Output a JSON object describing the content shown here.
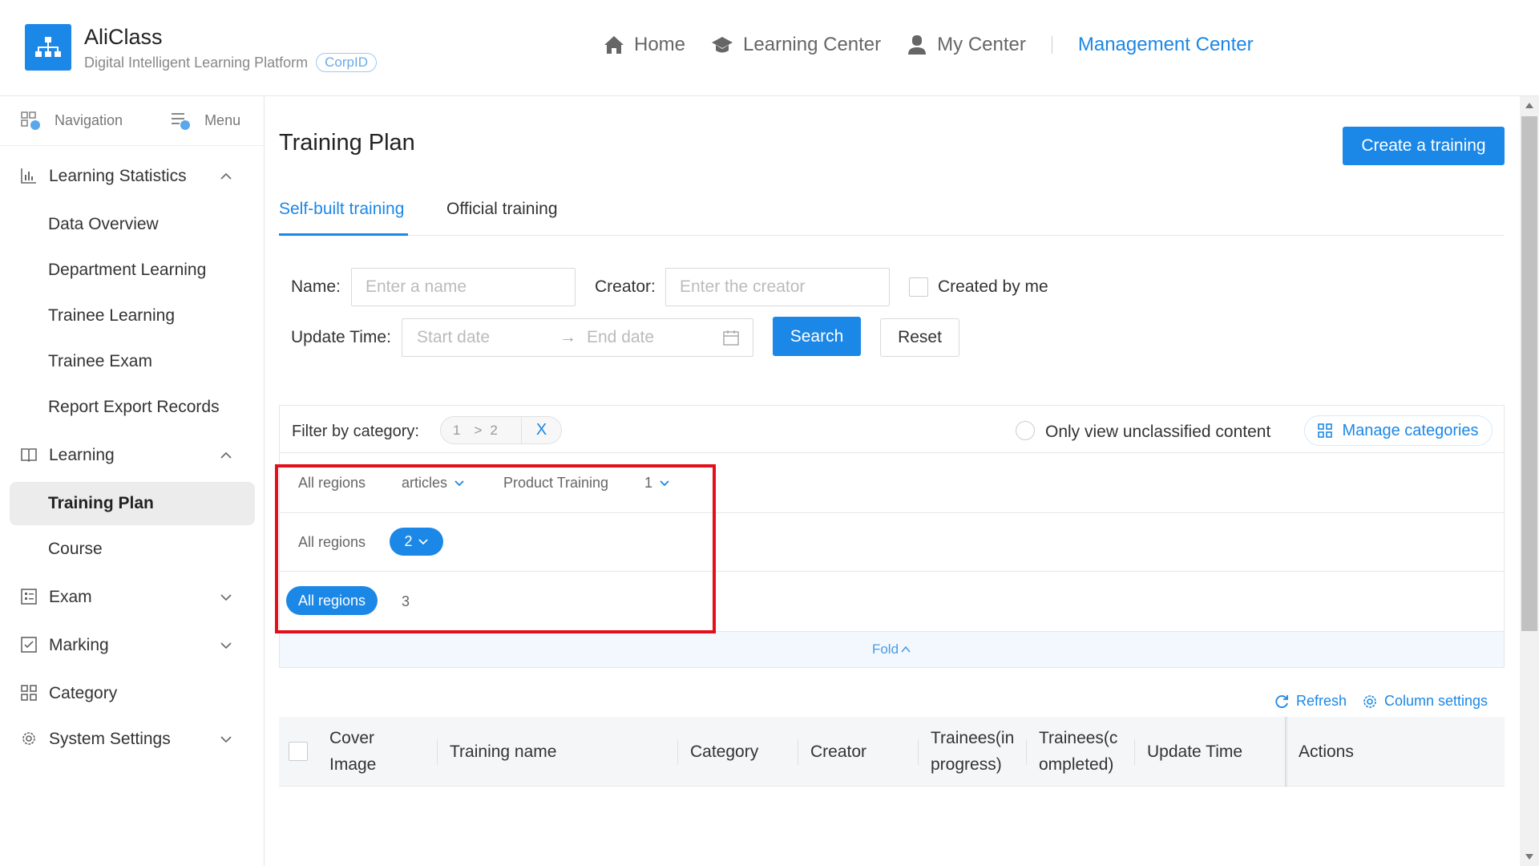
{
  "header": {
    "brand_name": "AliClass",
    "brand_sub": "Digital Intelligent Learning Platform",
    "corp_badge": "CorpID",
    "nav": {
      "home": "Home",
      "learning_center": "Learning Center",
      "my_center": "My Center",
      "management_center": "Management Center"
    },
    "accent_color": "#1b87e6"
  },
  "sidebar": {
    "navigation_label": "Navigation",
    "menu_label": "Menu",
    "groups": [
      {
        "label": "Learning Statistics",
        "icon": "bar-chart-icon",
        "expanded": true,
        "items": [
          "Data Overview",
          "Department Learning",
          "Trainee Learning",
          "Trainee Exam",
          "Report Export Records"
        ]
      },
      {
        "label": "Learning",
        "icon": "book-icon",
        "expanded": true,
        "items": [
          "Training Plan",
          "Course"
        ]
      },
      {
        "label": "Exam",
        "icon": "exam-icon",
        "expanded": false
      },
      {
        "label": "Marking",
        "icon": "marking-icon",
        "expanded": false
      },
      {
        "label": "Category",
        "icon": "category-grid-icon",
        "expanded": false
      },
      {
        "label": "System Settings",
        "icon": "gear-icon",
        "expanded": false
      }
    ],
    "active_item": "Training Plan"
  },
  "main": {
    "title": "Training Plan",
    "create_button": "Create a training",
    "tabs": [
      "Self-built training",
      "Official training"
    ],
    "active_tab": "Self-built training",
    "form": {
      "name_label": "Name",
      "name_placeholder": "Enter a name",
      "creator_label": "Creator",
      "creator_placeholder": "Enter the creator",
      "created_by_me": "Created by me",
      "update_time_label": "Update Time",
      "start_placeholder": "Start date",
      "end_placeholder": "End date",
      "search_button": "Search",
      "reset_button": "Reset"
    },
    "filter": {
      "label": "Filter by category:",
      "crumb_1": "1",
      "crumb_sep": ">",
      "crumb_2": "2",
      "clear": "X",
      "unclassified": "Only view unclassified content",
      "manage": "Manage categories",
      "rows": [
        {
          "all": "All regions",
          "opt1": "articles",
          "opt2": "Product Training",
          "opt3": "1"
        },
        {
          "all": "All regions",
          "selected": "2"
        },
        {
          "all_selected": "All regions",
          "opt": "3"
        }
      ],
      "fold": "Fold"
    },
    "toolbar": {
      "refresh": "Refresh",
      "column_settings": "Column settings"
    },
    "table": {
      "columns": [
        [
          "Cover",
          "Image"
        ],
        [
          "Training name"
        ],
        [
          "Category"
        ],
        [
          "Creator"
        ],
        [
          "Trainees(in",
          "progress)"
        ],
        [
          "Trainees(c",
          "ompleted)"
        ],
        [
          "Update Time"
        ],
        [
          "Actions"
        ]
      ]
    }
  }
}
